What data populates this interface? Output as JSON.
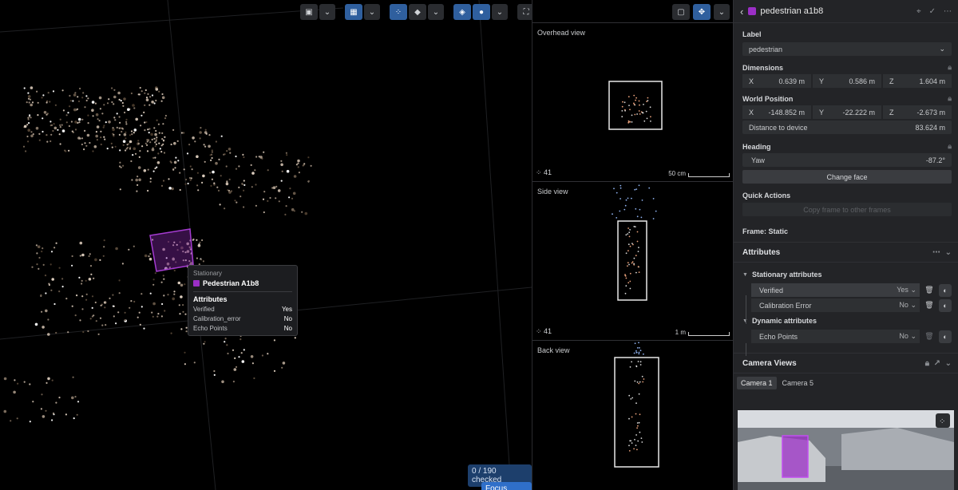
{
  "toolbar": {
    "left_icons": [
      "camera-icon",
      "chevron-down-icon",
      "layout-icon",
      "chevron-down-icon",
      "points-icon",
      "tag-icon",
      "chevron-down-icon",
      "layers-icon",
      "circle-icon",
      "chevron-down-icon",
      "fullscreen-icon"
    ],
    "views_icons": [
      "frame-icon",
      "move-icon",
      "chevron-down-icon"
    ]
  },
  "viewport": {
    "checked_label": "0 / 190 checked",
    "focus_label": "Focus mode"
  },
  "tooltip": {
    "status": "Stationary",
    "title": "Pedestrian A1b8",
    "section": "Attributes",
    "rows": [
      {
        "key": "Verified",
        "value": "Yes"
      },
      {
        "key": "Calibration_error",
        "value": "No"
      },
      {
        "key": "Echo Points",
        "value": "No"
      }
    ]
  },
  "views": [
    {
      "title": "Overhead view",
      "count": "41",
      "scale": "50 cm"
    },
    {
      "title": "Side view",
      "count": "41",
      "scale": "1 m"
    },
    {
      "title": "Back view",
      "count": "41",
      "scale": ""
    }
  ],
  "panel": {
    "title": "pedestrian a1b8",
    "label": {
      "title": "Label",
      "value": "pedestrian"
    },
    "dimensions": {
      "title": "Dimensions",
      "x": "0.639 m",
      "y": "0.586 m",
      "z": "1.604 m"
    },
    "world_position": {
      "title": "World Position",
      "x": "-148.852 m",
      "y": "-22.222 m",
      "z": "-2.673 m",
      "distance_label": "Distance to device",
      "distance_value": "83.624 m"
    },
    "heading": {
      "title": "Heading",
      "yaw_label": "Yaw",
      "yaw_value": "-87.2°",
      "change_face": "Change face"
    },
    "quick_actions": {
      "title": "Quick Actions",
      "copy_label": "Copy frame to other frames"
    },
    "frame_label": "Frame: Static",
    "attributes": {
      "title": "Attributes",
      "stationary_title": "Stationary attributes",
      "dynamic_title": "Dynamic attributes",
      "stationary": [
        {
          "name": "Verified",
          "value": "Yes"
        },
        {
          "name": "Calibration Error",
          "value": "No"
        }
      ],
      "dynamic": [
        {
          "name": "Echo Points",
          "value": "No"
        }
      ]
    },
    "camera_views": {
      "title": "Camera Views",
      "tabs": [
        "Camera 1",
        "Camera 5"
      ]
    }
  },
  "colors": {
    "accent": "#2f6fc9",
    "object": "#9b2fc6",
    "panel_bg": "#232427"
  }
}
